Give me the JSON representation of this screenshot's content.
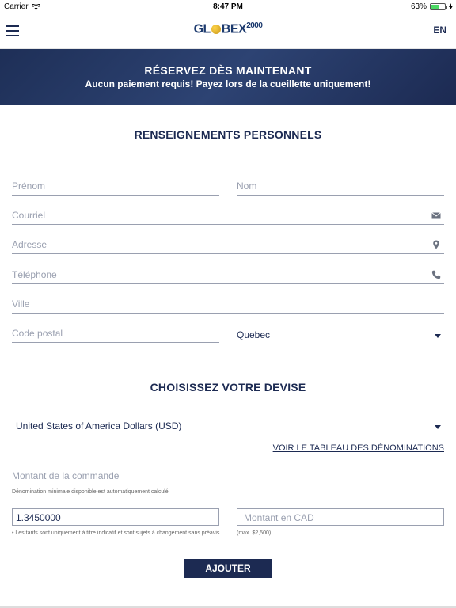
{
  "status_bar": {
    "carrier": "Carrier",
    "time": "8:47 PM",
    "battery": "63%",
    "battery_level": 0.63
  },
  "nav": {
    "logo_left": "GL",
    "logo_right": "BEX",
    "logo_year": "2000",
    "lang": "EN"
  },
  "banner": {
    "title": "RÉSERVEZ DÈS MAINTENANT",
    "subtitle": "Aucun paiement requis! Payez lors de la cueillette uniquement!"
  },
  "personal": {
    "title": "RENSEIGNEMENTS PERSONNELS",
    "first_name_placeholder": "Prénom",
    "last_name_placeholder": "Nom",
    "email_placeholder": "Courriel",
    "address_placeholder": "Adresse",
    "phone_placeholder": "Téléphone",
    "city_placeholder": "Ville",
    "postal_placeholder": "Code postal",
    "province_value": "Quebec"
  },
  "currency": {
    "title": "CHOISISSEZ VOTRE DEVISE",
    "selected": "United States of America Dollars (USD)",
    "denominations_link": "VOIR LE TABLEAU DES DÉNOMINATIONS",
    "amount_placeholder": "Montant de la commande",
    "amount_note": "Dénomination minimale disponible est automatiquement calculé.",
    "rate_value": "1.3450000",
    "cad_placeholder": "Montant en CAD",
    "rate_note": "• Les tarifs sont uniquement à titre indicatif et sont sujets à changement sans préavis",
    "cad_note": "(max. $2,500)",
    "add_button": "AJOUTER"
  },
  "colors": {
    "brand_navy": "#1c2a52",
    "field_line": "#9aa0b0"
  }
}
